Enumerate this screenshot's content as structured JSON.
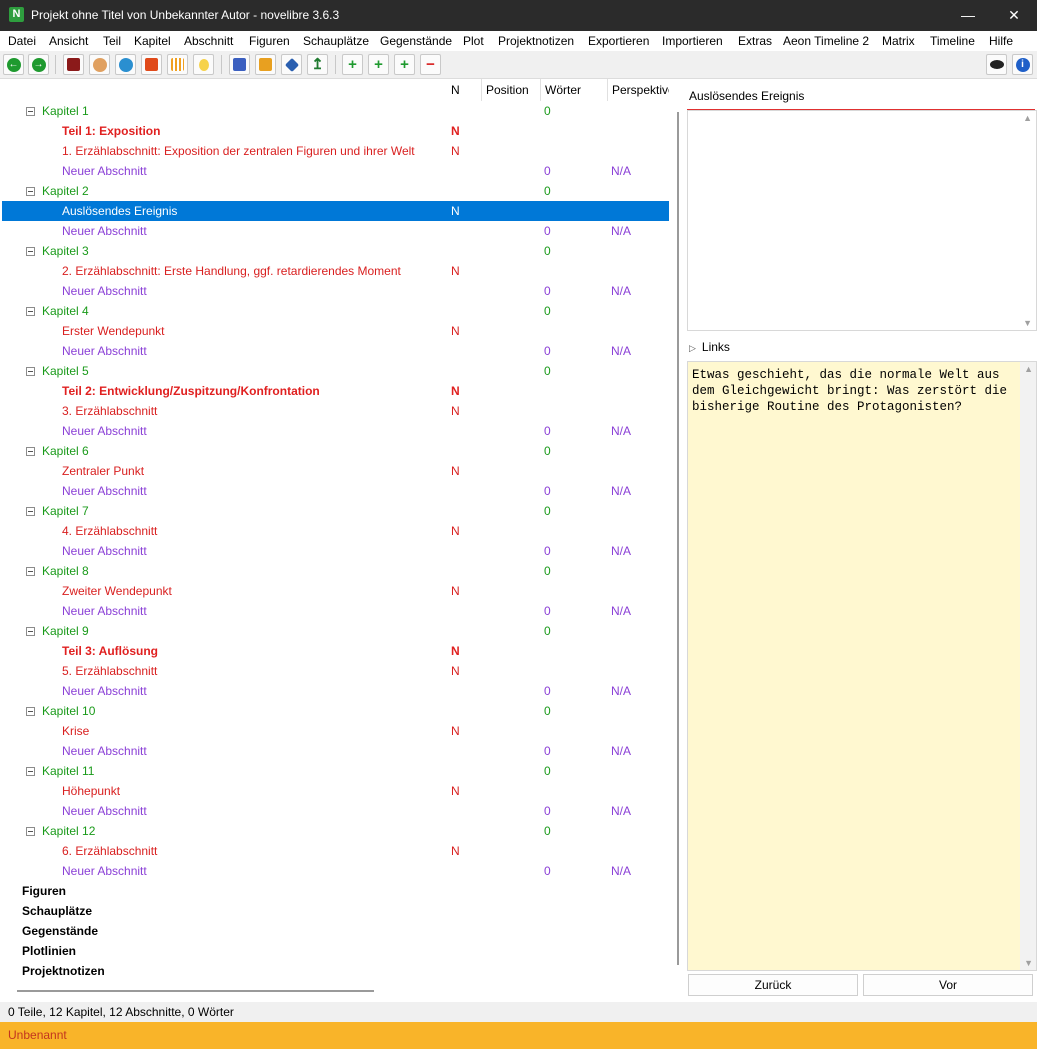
{
  "window": {
    "title": "Projekt ohne Titel von Unbekannter Autor - novelibre 3.6.3",
    "app_icon_letter": "N",
    "minimize": "—",
    "maximize": "☐",
    "close": "✕"
  },
  "menu": [
    "Datei",
    "Ansicht",
    "Teil",
    "Kapitel",
    "Abschnitt",
    "Figuren",
    "Schauplätze",
    "Gegenstände",
    "Plot",
    "Projektnotizen",
    "Exportieren",
    "Importieren",
    "Extras",
    "Aeon Timeline 2",
    "Matrix",
    "Timeline",
    "Hilfe"
  ],
  "toolbar": {
    "icons": [
      "back-icon",
      "forward-icon",
      "book-icon",
      "characters-icon",
      "globe-icon",
      "items-icon",
      "plot-lines-icon",
      "notes-bulb-icon",
      "save-icon",
      "lock-icon",
      "edit-icon",
      "export-icon",
      "add-icon",
      "add-child-icon",
      "add-parent-icon",
      "remove-icon",
      "view-icon",
      "info-icon"
    ],
    "accent_green": "#1f9a2f",
    "accent_red": "#d82020"
  },
  "tree": {
    "columns": [
      "N",
      "Position",
      "Wörter",
      "Perspektive"
    ],
    "rows": [
      {
        "level": 0,
        "kind": "chapter",
        "title": "Kapitel 1",
        "n": "",
        "words": "0",
        "pov": ""
      },
      {
        "level": 1,
        "kind": "part",
        "title": "Teil 1: Exposition",
        "n": "N",
        "words": "",
        "pov": ""
      },
      {
        "level": 1,
        "kind": "section",
        "title": "1. Erzählabschnitt: Exposition der zentralen Figuren und ihrer Welt",
        "n": "N",
        "words": "",
        "pov": ""
      },
      {
        "level": 1,
        "kind": "new",
        "title": "Neuer Abschnitt",
        "n": "",
        "words": "0",
        "pov": "N/A"
      },
      {
        "level": 0,
        "kind": "chapter",
        "title": "Kapitel 2",
        "n": "",
        "words": "0",
        "pov": ""
      },
      {
        "level": 1,
        "kind": "selected",
        "title": "Auslösendes Ereignis",
        "n": "N",
        "words": "",
        "pov": ""
      },
      {
        "level": 1,
        "kind": "new",
        "title": "Neuer Abschnitt",
        "n": "",
        "words": "0",
        "pov": "N/A"
      },
      {
        "level": 0,
        "kind": "chapter",
        "title": "Kapitel 3",
        "n": "",
        "words": "0",
        "pov": ""
      },
      {
        "level": 1,
        "kind": "section",
        "title": "2. Erzählabschnitt: Erste Handlung, ggf. retardierendes Moment",
        "n": "N",
        "words": "",
        "pov": ""
      },
      {
        "level": 1,
        "kind": "new",
        "title": "Neuer Abschnitt",
        "n": "",
        "words": "0",
        "pov": "N/A"
      },
      {
        "level": 0,
        "kind": "chapter",
        "title": "Kapitel 4",
        "n": "",
        "words": "0",
        "pov": ""
      },
      {
        "level": 1,
        "kind": "section",
        "title": "Erster Wendepunkt",
        "n": "N",
        "words": "",
        "pov": ""
      },
      {
        "level": 1,
        "kind": "new",
        "title": "Neuer Abschnitt",
        "n": "",
        "words": "0",
        "pov": "N/A"
      },
      {
        "level": 0,
        "kind": "chapter",
        "title": "Kapitel 5",
        "n": "",
        "words": "0",
        "pov": ""
      },
      {
        "level": 1,
        "kind": "part",
        "title": "Teil 2: Entwicklung/Zuspitzung/Konfrontation",
        "n": "N",
        "words": "",
        "pov": ""
      },
      {
        "level": 1,
        "kind": "section",
        "title": "3. Erzählabschnitt",
        "n": "N",
        "words": "",
        "pov": ""
      },
      {
        "level": 1,
        "kind": "new",
        "title": "Neuer Abschnitt",
        "n": "",
        "words": "0",
        "pov": "N/A"
      },
      {
        "level": 0,
        "kind": "chapter",
        "title": "Kapitel 6",
        "n": "",
        "words": "0",
        "pov": ""
      },
      {
        "level": 1,
        "kind": "section",
        "title": "Zentraler Punkt",
        "n": "N",
        "words": "",
        "pov": ""
      },
      {
        "level": 1,
        "kind": "new",
        "title": "Neuer Abschnitt",
        "n": "",
        "words": "0",
        "pov": "N/A"
      },
      {
        "level": 0,
        "kind": "chapter",
        "title": "Kapitel 7",
        "n": "",
        "words": "0",
        "pov": ""
      },
      {
        "level": 1,
        "kind": "section",
        "title": "4. Erzählabschnitt",
        "n": "N",
        "words": "",
        "pov": ""
      },
      {
        "level": 1,
        "kind": "new",
        "title": "Neuer Abschnitt",
        "n": "",
        "words": "0",
        "pov": "N/A"
      },
      {
        "level": 0,
        "kind": "chapter",
        "title": "Kapitel 8",
        "n": "",
        "words": "0",
        "pov": ""
      },
      {
        "level": 1,
        "kind": "section",
        "title": "Zweiter Wendepunkt",
        "n": "N",
        "words": "",
        "pov": ""
      },
      {
        "level": 1,
        "kind": "new",
        "title": "Neuer Abschnitt",
        "n": "",
        "words": "0",
        "pov": "N/A"
      },
      {
        "level": 0,
        "kind": "chapter",
        "title": "Kapitel 9",
        "n": "",
        "words": "0",
        "pov": ""
      },
      {
        "level": 1,
        "kind": "part",
        "title": "Teil 3: Auflösung",
        "n": "N",
        "words": "",
        "pov": ""
      },
      {
        "level": 1,
        "kind": "section",
        "title": "5. Erzählabschnitt",
        "n": "N",
        "words": "",
        "pov": ""
      },
      {
        "level": 1,
        "kind": "new",
        "title": "Neuer Abschnitt",
        "n": "",
        "words": "0",
        "pov": "N/A"
      },
      {
        "level": 0,
        "kind": "chapter",
        "title": "Kapitel 10",
        "n": "",
        "words": "0",
        "pov": ""
      },
      {
        "level": 1,
        "kind": "section",
        "title": "Krise",
        "n": "N",
        "words": "",
        "pov": ""
      },
      {
        "level": 1,
        "kind": "new",
        "title": "Neuer Abschnitt",
        "n": "",
        "words": "0",
        "pov": "N/A"
      },
      {
        "level": 0,
        "kind": "chapter",
        "title": "Kapitel 11",
        "n": "",
        "words": "0",
        "pov": ""
      },
      {
        "level": 1,
        "kind": "section",
        "title": "Höhepunkt",
        "n": "N",
        "words": "",
        "pov": ""
      },
      {
        "level": 1,
        "kind": "new",
        "title": "Neuer Abschnitt",
        "n": "",
        "words": "0",
        "pov": "N/A"
      },
      {
        "level": 0,
        "kind": "chapter",
        "title": "Kapitel 12",
        "n": "",
        "words": "0",
        "pov": ""
      },
      {
        "level": 1,
        "kind": "section",
        "title": "6. Erzählabschnitt",
        "n": "N",
        "words": "",
        "pov": ""
      },
      {
        "level": 1,
        "kind": "new",
        "title": "Neuer Abschnitt",
        "n": "",
        "words": "0",
        "pov": "N/A"
      },
      {
        "level": -1,
        "kind": "category",
        "title": "Figuren",
        "n": "",
        "words": "",
        "pov": ""
      },
      {
        "level": -1,
        "kind": "category",
        "title": "Schauplätze",
        "n": "",
        "words": "",
        "pov": ""
      },
      {
        "level": -1,
        "kind": "category",
        "title": "Gegenstände",
        "n": "",
        "words": "",
        "pov": ""
      },
      {
        "level": -1,
        "kind": "category",
        "title": "Plotlinien",
        "n": "",
        "words": "",
        "pov": ""
      },
      {
        "level": -1,
        "kind": "category",
        "title": "Projektnotizen",
        "n": "",
        "words": "",
        "pov": ""
      }
    ]
  },
  "right_panel": {
    "title": "Auslösendes Ereignis",
    "links_label": "Links",
    "notes": "Etwas geschieht, das die normale Welt aus dem Gleichgewicht bringt: Was zerstört die bisherige Routine des Protagonisten?",
    "back_button": "Zurück",
    "forward_button": "Vor"
  },
  "status": {
    "summary": "0 Teile, 12 Kapitel, 12 Abschnitte, 0 Wörter",
    "footer": "Unbenannt"
  }
}
